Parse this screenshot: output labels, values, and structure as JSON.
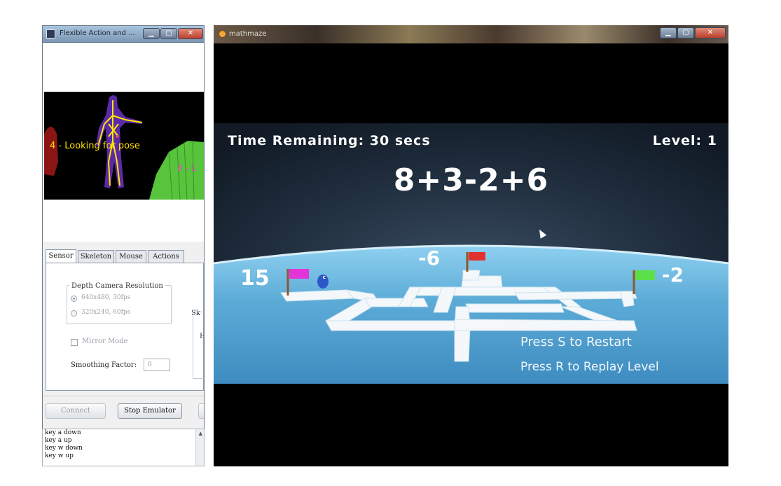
{
  "left_window": {
    "title": "Flexible Action and ...",
    "pose_status": "4 - Looking for pose",
    "pose_status_secondary": "8 - L",
    "tabs": [
      {
        "label": "Sensor",
        "active": true
      },
      {
        "label": "Skeleton",
        "active": false
      },
      {
        "label": "Mouse",
        "active": false
      },
      {
        "label": "Actions",
        "active": false
      }
    ],
    "depth_camera": {
      "title": "Depth Camera Resolution",
      "options": [
        {
          "label": "640x480, 30fps",
          "selected": true
        },
        {
          "label": "320x240, 60fps",
          "selected": false
        }
      ]
    },
    "skeleton_group_label_partial": "Sk",
    "skeleton_group_sub_partial": "H",
    "mirror_mode_label": "Mirror Mode",
    "smoothing_label": "Smoothing Factor:",
    "smoothing_value": "0",
    "connect_label": "Connect",
    "stop_emulator_label": "Stop Emulator",
    "log_lines": [
      "key a down",
      "key a up",
      "key w down",
      "key w up"
    ]
  },
  "game_window": {
    "title": "mathmaze",
    "time_remaining": "Time Remaining: 30 secs",
    "level": "Level: 1",
    "expression": "8+3-2+6",
    "flag_values": {
      "left": "15",
      "top": "-6",
      "right": "-2"
    },
    "prompt_restart": "Press S to Restart",
    "prompt_replay": "Press R to Replay Level"
  },
  "colors": {
    "flag_left": "#e433d6",
    "flag_top": "#e2302d",
    "flag_right": "#5be04a",
    "skeleton_line": "#ffe600",
    "skeleton_body": "#5b2aa8",
    "status_text": "#ffe100",
    "ice": "#58a8d6"
  }
}
